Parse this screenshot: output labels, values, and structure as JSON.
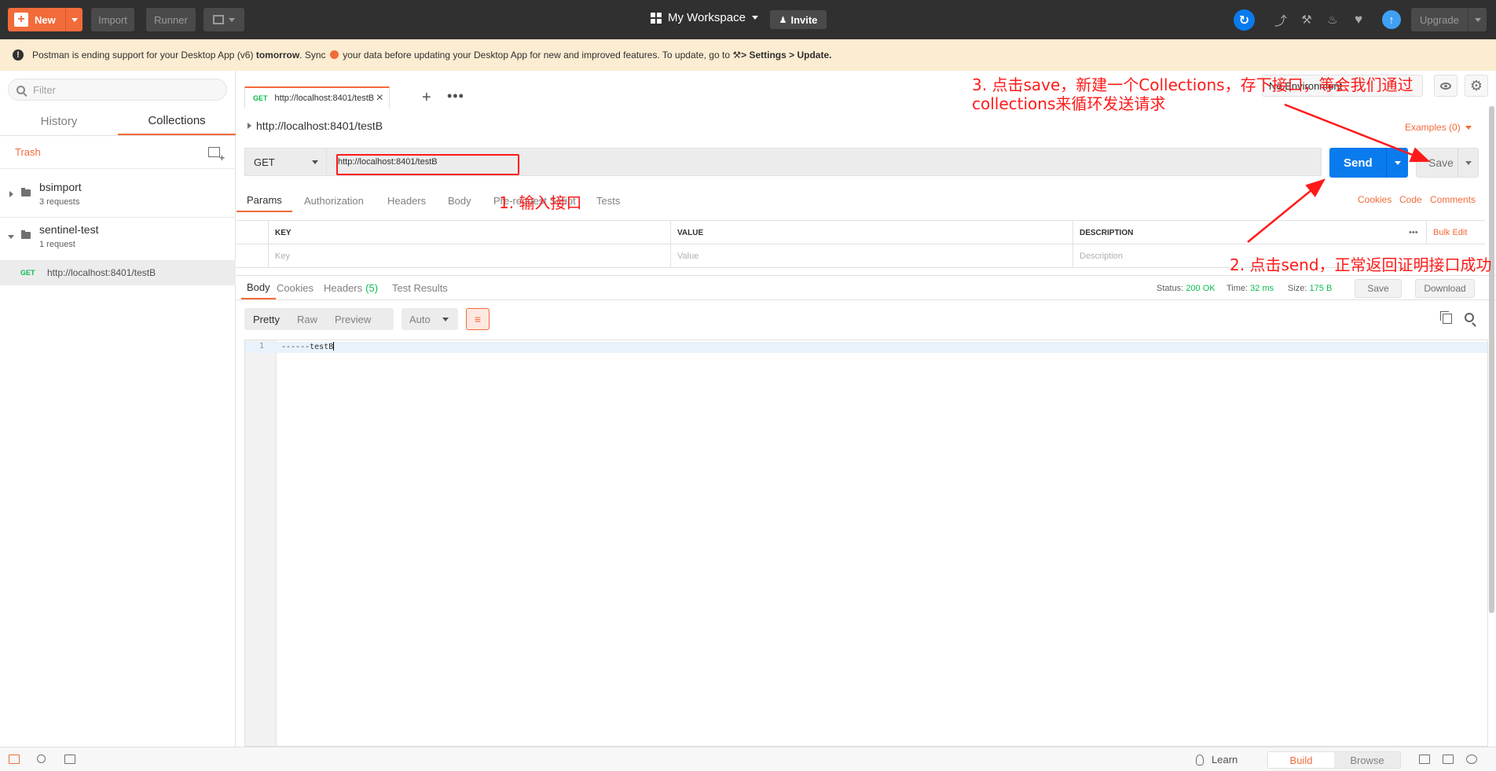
{
  "topbar": {
    "new_label": "New",
    "import_label": "Import",
    "runner_label": "Runner",
    "workspace_label": "My Workspace",
    "invite_label": "Invite",
    "upgrade_label": "Upgrade"
  },
  "banner": {
    "text_1": "Postman is ending support for your Desktop App (v6)",
    "text_bold_1": "tomorrow",
    "text_2": ". Sync",
    "text_3": "your data before updating your Desktop App for new and improved features. To update, go to",
    "text_bold_2": "> Settings > Update."
  },
  "sidebar": {
    "filter_placeholder": "Filter",
    "tabs": [
      "History",
      "Collections"
    ],
    "trash_label": "Trash",
    "collections": [
      {
        "name": "bsimport",
        "count": "3 requests"
      },
      {
        "name": "sentinel-test",
        "count": "1 request"
      }
    ],
    "request": {
      "method": "GET",
      "url": "http://localhost:8401/testB"
    }
  },
  "main": {
    "tab": {
      "method": "GET",
      "url": "http://localhost:8401/testB"
    },
    "environment": "No Environment",
    "request_title": "http://localhost:8401/testB",
    "examples_label": "Examples (0)",
    "method": "GET",
    "url_value": "http://localhost:8401/testB",
    "send_label": "Send",
    "save_label": "Save",
    "request_tabs": [
      "Params",
      "Authorization",
      "Headers",
      "Body",
      "Pre-request Script",
      "Tests"
    ],
    "links": [
      "Cookies",
      "Code",
      "Comments"
    ],
    "params": {
      "headers": [
        "KEY",
        "VALUE",
        "DESCRIPTION"
      ],
      "placeholders": [
        "Key",
        "Value",
        "Description"
      ],
      "more": "•••",
      "bulk_edit": "Bulk Edit"
    },
    "response": {
      "tabs": [
        "Body",
        "Cookies",
        "Headers",
        "Test Results"
      ],
      "headers_count": "(5)",
      "status_label": "Status:",
      "status_value": "200 OK",
      "time_label": "Time:",
      "time_value": "32 ms",
      "size_label": "Size:",
      "size_value": "175 B",
      "save_label": "Save",
      "download_label": "Download",
      "formats": [
        "Pretty",
        "Raw",
        "Preview"
      ],
      "type_select": "Auto",
      "line_number": "1",
      "body": "------testB"
    }
  },
  "bottombar": {
    "learn_label": "Learn",
    "build_label": "Build",
    "browse_label": "Browse"
  },
  "annotations": {
    "a1": "1. 输入接口",
    "a2": "2. 点击send，正常返回证明接口成功",
    "a3": "3. 点击save，新建一个Collections，存下接口，等会我们通过collections来循环发送请求",
    "color": "#ff1a1a"
  },
  "colors": {
    "accent": "#f26b3a",
    "send_blue": "#097bed",
    "get_green": "#0cbb52",
    "topbar": "#303030"
  }
}
